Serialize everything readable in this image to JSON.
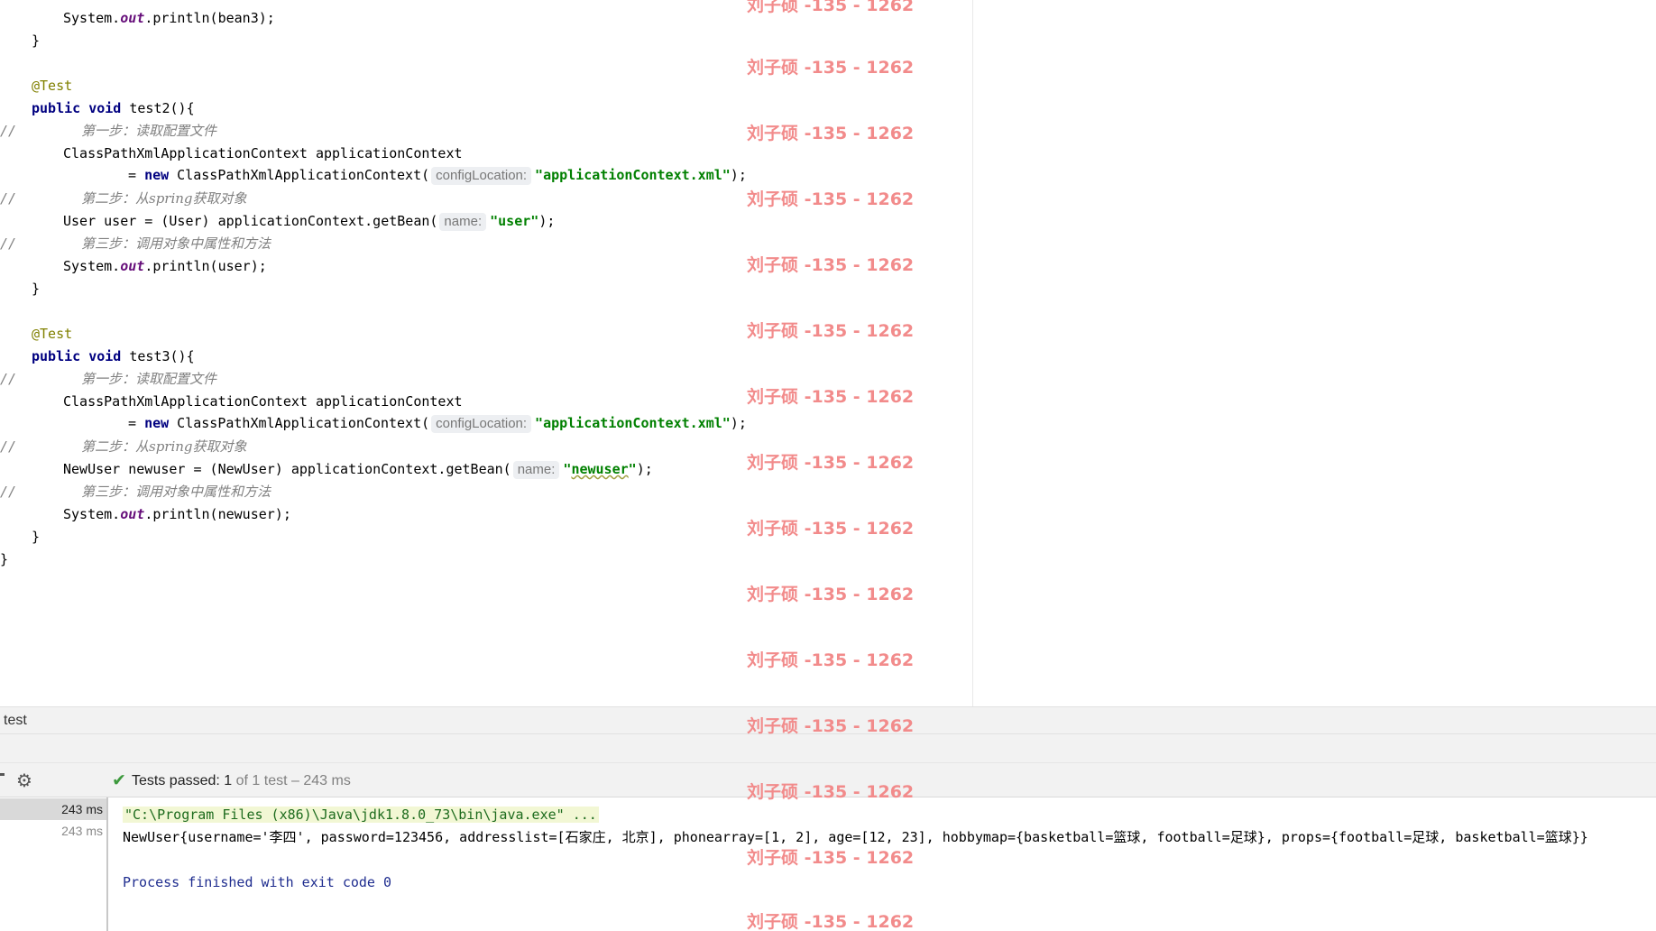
{
  "editor": {
    "lines": {
      "l1": "System.",
      "l1_field": "out",
      "l1_rest": ".println(bean3);",
      "l2": "}",
      "l3": "@Test",
      "l4_kw": "public void",
      "l4_rest": " test2(){",
      "comment_prefix": "//",
      "c1": "第一步：读取配置文件",
      "l6": "ClassPathXmlApplicationContext applicationContext",
      "l7_eq": "= ",
      "l7_new": "new",
      "l7_rest": " ClassPathXmlApplicationContext(",
      "hint_config": "configLocation:",
      "str_xml": "\"applicationContext.xml\"",
      "close_paren": ");",
      "c2": "第二步：从spring获取对象",
      "l9": "User user = (User) applicationContext.getBean(",
      "hint_name": "name:",
      "str_user": "\"user\"",
      "c3": "第三步：调用对象中属性和方法",
      "l11_rest": ".println(user);",
      "l12": "}",
      "l13": "@Test",
      "l14_rest": " test3(){",
      "l19": "NewUser newuser = (NewUser) applicationContext.getBean(",
      "str_q": "\"",
      "str_newuser": "newuser",
      "l21_rest": ".println(newuser);",
      "l22": "}",
      "l23": "}"
    }
  },
  "watermark": "刘子硕 -135 - 1262",
  "run_panel": {
    "title": "test",
    "status": {
      "label": "Tests passed: ",
      "count": "1",
      "detail": " of 1 test – 243 ms"
    },
    "tree": [
      "243 ms",
      "243 ms"
    ],
    "console": {
      "cmd": "\"C:\\Program Files (x86)\\Java\\jdk1.8.0_73\\bin\\java.exe\" ...",
      "output": "NewUser{username='李四', password=123456, addresslist=[石家庄, 北京], phonearray=[1, 2], age=[12, 23], hobbymap={basketball=篮球, football=足球}, props={football=足球, basketball=篮球}}",
      "exit": "Process finished with exit code 0"
    }
  },
  "icons": {
    "gear": "⚙",
    "check": "✔"
  }
}
